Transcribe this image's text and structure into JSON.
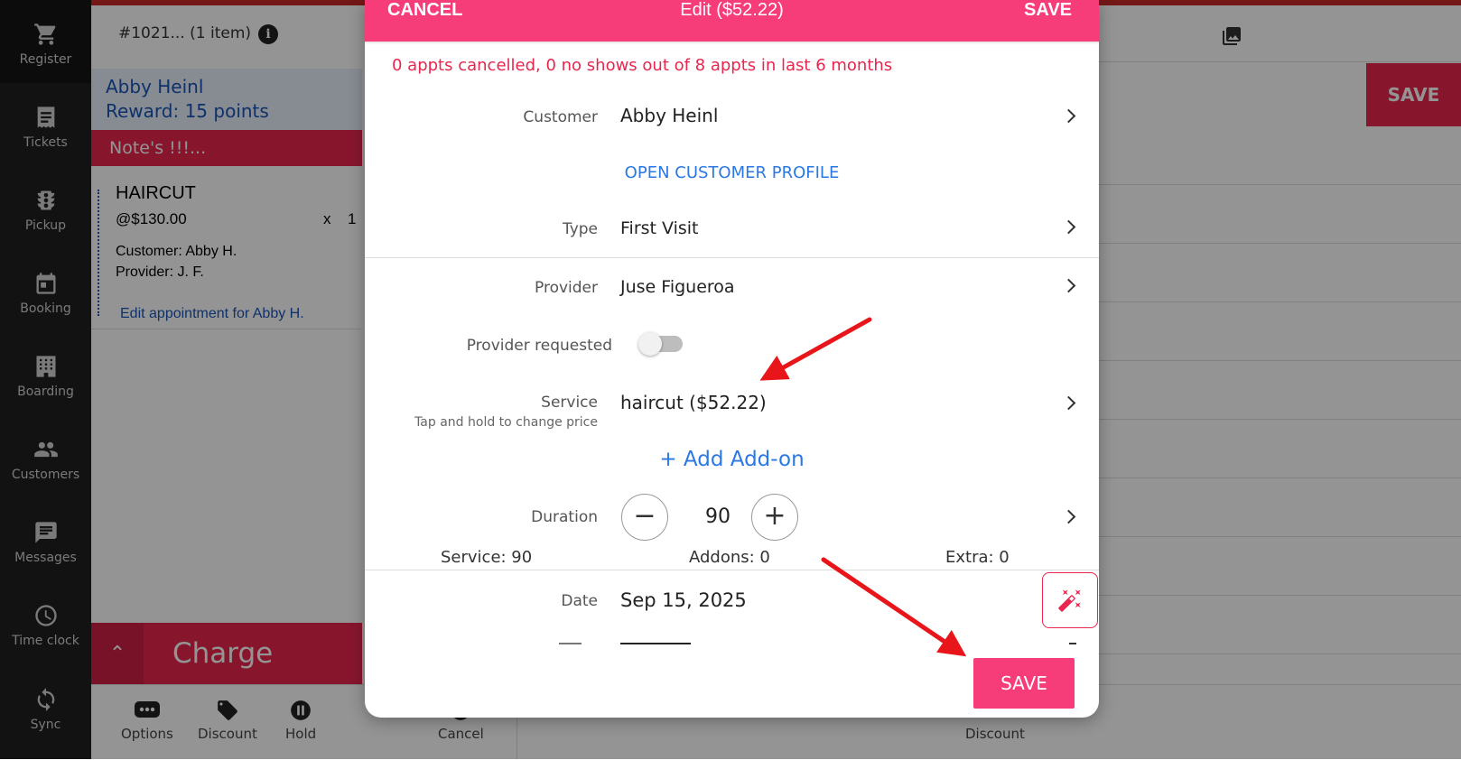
{
  "sidebar": {
    "items": [
      {
        "label": "Register",
        "icon": "cart-icon"
      },
      {
        "label": "Tickets",
        "icon": "list-icon"
      },
      {
        "label": "Pickup",
        "icon": "traffic-light-icon"
      },
      {
        "label": "Booking",
        "icon": "calendar-icon"
      },
      {
        "label": "Boarding",
        "icon": "building-icon"
      },
      {
        "label": "Customers",
        "icon": "people-icon"
      },
      {
        "label": "Messages",
        "icon": "message-icon"
      },
      {
        "label": "Time clock",
        "icon": "clock-icon"
      },
      {
        "label": "Sync",
        "icon": "sync-icon"
      }
    ]
  },
  "ticket": {
    "id": "#1021... (1 item)",
    "customer_name": "Abby Heinl",
    "reward": "Reward: 15 points",
    "note": "Note's !!!...",
    "line_item": {
      "name": "HAIRCUT",
      "price": "@$130.00",
      "x": "x",
      "qty": "1",
      "customer": "Customer: Abby H.",
      "provider": "Provider: J. F.",
      "edit_link": "Edit appointment for Abby H."
    },
    "charge_label": "Charge"
  },
  "bottom_bar": {
    "options": "Options",
    "discount": "Discount",
    "hold": "Hold",
    "cancel": "Cancel",
    "discount2": "Discount"
  },
  "right_panel": {
    "save_label": "SAVE"
  },
  "modal": {
    "cancel_label": "CANCEL",
    "title": "Edit ($52.22)",
    "save_label": "SAVE",
    "stats": "0 appts cancelled, 0 no shows out of 8 appts in last 6 months",
    "customer_label": "Customer",
    "customer_value": "Abby Heinl",
    "open_profile": "OPEN CUSTOMER PROFILE",
    "type_label": "Type",
    "type_value": "First Visit",
    "provider_label": "Provider",
    "provider_value": "Juse Figueroa",
    "provider_requested_label": "Provider requested",
    "provider_requested_on": false,
    "service_label": "Service",
    "service_hint": "Tap and hold to change price",
    "service_value": "haircut ($52.22)",
    "add_addon": "+ Add Add-on",
    "duration_label": "Duration",
    "duration_value": "90",
    "service_dur": "Service: 90",
    "addons_dur": "Addons: 0",
    "extra_dur": "Extra: 0",
    "date_label": "Date",
    "date_value": "Sep 15, 2025",
    "footer_save": "SAVE"
  },
  "colors": {
    "accent_pink": "#f73c7a",
    "brand_red": "#e8264e",
    "link_blue": "#2a78e4",
    "annotation_arrow": "#e8161b"
  }
}
